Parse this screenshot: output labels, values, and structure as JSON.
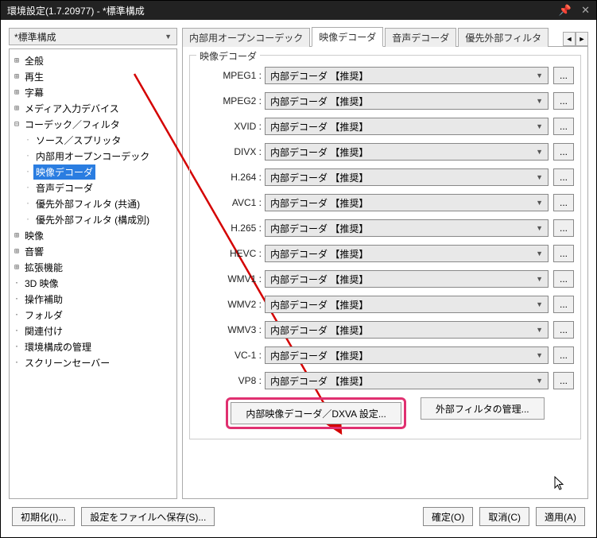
{
  "window": {
    "title": "環境設定(1.7.20977) - *標準構成",
    "pin_icon": "📌",
    "close_icon": "✕"
  },
  "preset": {
    "selected": "*標準構成"
  },
  "tree": [
    {
      "level": 0,
      "tw": "⊞",
      "label": "全般"
    },
    {
      "level": 0,
      "tw": "⊞",
      "label": "再生"
    },
    {
      "level": 0,
      "tw": "⊞",
      "label": "字幕"
    },
    {
      "level": 0,
      "tw": "⊞",
      "label": "メディア入力デバイス"
    },
    {
      "level": 0,
      "tw": "⊟",
      "label": "コーデック／フィルタ"
    },
    {
      "level": 1,
      "tw": "",
      "label": "ソース／スプリッタ"
    },
    {
      "level": 1,
      "tw": "",
      "label": "内部用オープンコーデック"
    },
    {
      "level": 1,
      "tw": "",
      "label": "映像デコーダ",
      "selected": true
    },
    {
      "level": 1,
      "tw": "",
      "label": "音声デコーダ"
    },
    {
      "level": 1,
      "tw": "",
      "label": "優先外部フィルタ (共通)"
    },
    {
      "level": 1,
      "tw": "",
      "label": "優先外部フィルタ (構成別)"
    },
    {
      "level": 0,
      "tw": "⊞",
      "label": "映像"
    },
    {
      "level": 0,
      "tw": "⊞",
      "label": "音響"
    },
    {
      "level": 0,
      "tw": "⊞",
      "label": "拡張機能"
    },
    {
      "level": 0,
      "tw": "",
      "label": "3D 映像"
    },
    {
      "level": 0,
      "tw": "",
      "label": "操作補助"
    },
    {
      "level": 0,
      "tw": "",
      "label": "フォルダ"
    },
    {
      "level": 0,
      "tw": "",
      "label": "関連付け"
    },
    {
      "level": 0,
      "tw": "",
      "label": "環境構成の管理"
    },
    {
      "level": 0,
      "tw": "",
      "label": "スクリーンセーバー"
    }
  ],
  "tabs": {
    "items": [
      {
        "label": "内部用オープンコーデック",
        "active": false
      },
      {
        "label": "映像デコーダ",
        "active": true
      },
      {
        "label": "音声デコーダ",
        "active": false
      },
      {
        "label": "優先外部フィルタ",
        "active": false
      }
    ],
    "scroll_left": "◄",
    "scroll_right": "►"
  },
  "group": {
    "title": "映像デコーダ"
  },
  "decoders": [
    {
      "name": "MPEG1 :",
      "value": "内部デコーダ 【推奨】"
    },
    {
      "name": "MPEG2 :",
      "value": "内部デコーダ 【推奨】"
    },
    {
      "name": "XVID :",
      "value": "内部デコーダ 【推奨】"
    },
    {
      "name": "DIVX :",
      "value": "内部デコーダ 【推奨】"
    },
    {
      "name": "H.264 :",
      "value": "内部デコーダ 【推奨】"
    },
    {
      "name": "AVC1 :",
      "value": "内部デコーダ 【推奨】"
    },
    {
      "name": "H.265 :",
      "value": "内部デコーダ 【推奨】"
    },
    {
      "name": "HEVC :",
      "value": "内部デコーダ 【推奨】"
    },
    {
      "name": "WMV1 :",
      "value": "内部デコーダ 【推奨】"
    },
    {
      "name": "WMV2 :",
      "value": "内部デコーダ 【推奨】"
    },
    {
      "name": "WMV3 :",
      "value": "内部デコーダ 【推奨】"
    },
    {
      "name": "VC-1 :",
      "value": "内部デコーダ 【推奨】"
    },
    {
      "name": "VP8 :",
      "value": "内部デコーダ 【推奨】"
    }
  ],
  "more_label": "...",
  "btn_dxva": "内部映像デコーダ／DXVA 設定...",
  "btn_ext_mgr": "外部フィルタの管理...",
  "footer": {
    "init": "初期化(I)...",
    "save": "設定をファイルへ保存(S)...",
    "ok": "確定(O)",
    "cancel": "取消(C)",
    "apply": "適用(A)"
  },
  "annotation": {
    "color": "#d40000"
  }
}
